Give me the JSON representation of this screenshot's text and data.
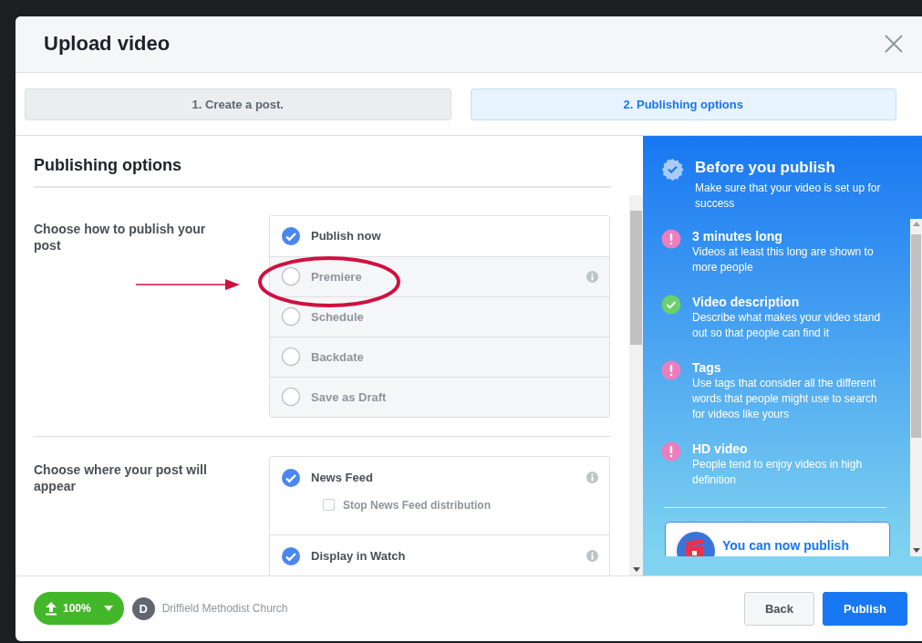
{
  "window": {
    "title": "Upload video"
  },
  "steps": [
    {
      "label": "1. Create a post.",
      "selected": false
    },
    {
      "label": "2. Publishing options",
      "selected": true
    }
  ],
  "publishing": {
    "heading": "Publishing options",
    "method": {
      "label": "Choose how to publish your post",
      "options": [
        {
          "label": "Publish now",
          "selected": true,
          "info": false
        },
        {
          "label": "Premiere",
          "selected": false,
          "info": true
        },
        {
          "label": "Schedule",
          "selected": false,
          "info": false
        },
        {
          "label": "Backdate",
          "selected": false,
          "info": false
        },
        {
          "label": "Save as Draft",
          "selected": false,
          "info": false
        }
      ]
    },
    "placement": {
      "label": "Choose where your post will appear",
      "items": [
        {
          "label": "News Feed",
          "checked": true,
          "info": true,
          "sub_option": {
            "label": "Stop News Feed distribution",
            "checked": false
          }
        },
        {
          "label": "Display in Watch",
          "checked": true,
          "info": true
        }
      ]
    }
  },
  "annotations": [
    {
      "kind": "arrow"
    },
    {
      "kind": "ellipse"
    }
  ],
  "tips_panel": {
    "title": "Before you publish",
    "subtitle": "Make sure that your video is set up for success",
    "tips": [
      {
        "title": "3 minutes long",
        "description": "Videos at least this long are shown to more people",
        "kind": "warning"
      },
      {
        "title": "Video description",
        "description": "Describe what makes your video stand out so that people can find it",
        "kind": "done"
      },
      {
        "title": "Tags",
        "description": "Use tags that consider all the different words that people might use to search for videos like yours",
        "kind": "warning"
      },
      {
        "title": "HD video",
        "description": "People tend to enjoy videos in high definition",
        "kind": "warning"
      }
    ],
    "promo": {
      "title": "You can now publish"
    }
  },
  "footer": {
    "upload": {
      "progress": "100%"
    },
    "page": {
      "initial": "D",
      "name": "Driffield Methodist Church"
    },
    "buttons": [
      {
        "label": "Back",
        "kind": "secondary"
      },
      {
        "label": "Publish",
        "kind": "primary"
      }
    ]
  }
}
